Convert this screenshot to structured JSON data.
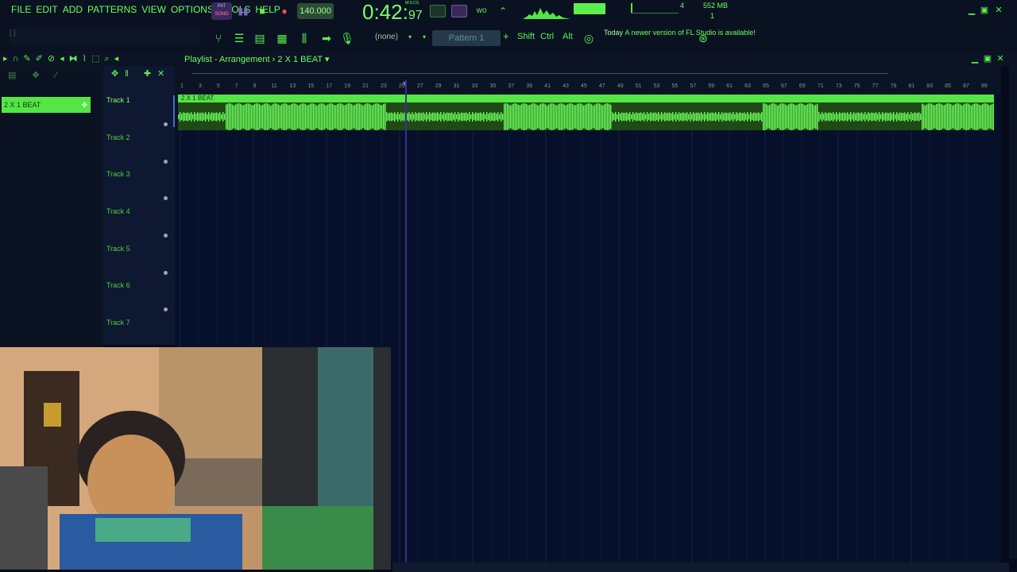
{
  "menu": [
    "FILE",
    "EDIT",
    "ADD",
    "PATTERNS",
    "VIEW",
    "OPTIONS",
    "TOOLS",
    "HELP"
  ],
  "transport": {
    "pat_label": "PAT",
    "song_label": "SONG",
    "tempo": "140.000",
    "time_main": "0:42:",
    "time_sub": "97",
    "time_unit": "M:S:CS"
  },
  "monitor": {
    "value1": "4",
    "value2": "1",
    "memory": "552 MB"
  },
  "toolbar": {
    "hint": "[ ]",
    "instrument": "(none)",
    "pattern": "Pattern 1",
    "plus": "+",
    "shift": "Shift",
    "ctrl": "Ctrl",
    "alt": "Alt",
    "news_today": "Today",
    "news_text": "A newer version of FL Studio is available!"
  },
  "playlist": {
    "title": "Playlist - Arrangement",
    "arrangement": "2 X 1 BEAT",
    "pattern_item": "2 X 1 BEAT",
    "clip_name": "2 X 1 BEAT",
    "tracks": [
      "Track 1",
      "Track 2",
      "Track 3",
      "Track 4",
      "Track 5",
      "Track 6",
      "Track 7"
    ],
    "ruler": [
      "1",
      "3",
      "5",
      "7",
      "9",
      "11",
      "13",
      "15",
      "17",
      "19",
      "21",
      "23",
      "25",
      "27",
      "29",
      "31",
      "33",
      "35",
      "37",
      "39",
      "41",
      "43",
      "45",
      "47",
      "49",
      "51",
      "53",
      "55",
      "57",
      "59",
      "61",
      "63",
      "65",
      "67",
      "69",
      "71",
      "73",
      "75",
      "77",
      "79",
      "81",
      "83",
      "85",
      "87",
      "89"
    ]
  },
  "colors": {
    "accent": "#53e645",
    "background": "#07102a",
    "playhead": "#3b2f8a"
  },
  "icons": [
    "magnet-icon",
    "pencil-icon",
    "paint-icon",
    "delete-icon",
    "mute-icon",
    "slip-icon",
    "slice-icon",
    "select-icon",
    "zoom-icon",
    "play-icon",
    "mixer-icon",
    "piano-roll-icon",
    "channel-rack-icon",
    "browser-icon",
    "record-icon",
    "metronome-icon",
    "online-icon"
  ]
}
